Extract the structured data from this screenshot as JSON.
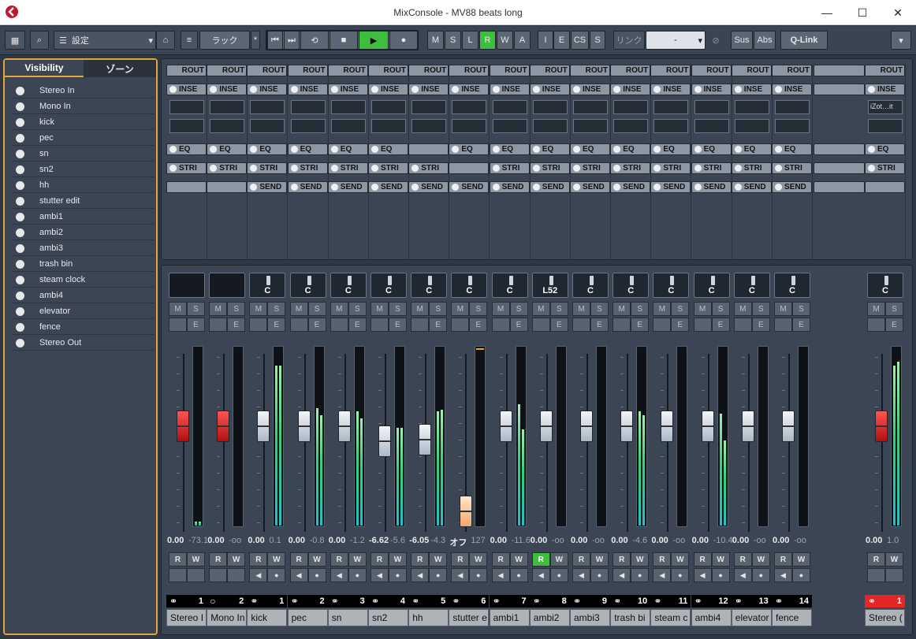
{
  "window": {
    "title": "MixConsole - MV88 beats long",
    "minimize": "—",
    "maximize": "☐",
    "close": "✕"
  },
  "toolbar": {
    "settings_label": "設定",
    "rack_label": "ラック",
    "star": "*",
    "modes": [
      "M",
      "S",
      "L",
      "R",
      "W",
      "A"
    ],
    "flags": [
      "I",
      "E",
      "CS",
      "S"
    ],
    "link_label": "リンク",
    "link_value": "-",
    "sus": "Sus",
    "abs": "Abs",
    "qlink": "Q-Link",
    "colors": {
      "rec_active": "#3fbd3f",
      "accent": "#e7a23a"
    }
  },
  "left_zone": {
    "tabs": [
      "Visibility",
      "ゾーン"
    ],
    "items": [
      "Stereo In",
      "Mono In",
      "kick",
      "pec",
      "sn",
      "sn2",
      "hh",
      "stutter edit",
      "ambi1",
      "ambi2",
      "ambi3",
      "trash bin",
      "steam clock",
      "ambi4",
      "elevator",
      "fence",
      "Stereo Out"
    ]
  },
  "rack_labels": {
    "routing": "ROUT",
    "inserts": "INSE",
    "eq": "EQ",
    "strip": "STRI",
    "sends": "SEND",
    "insert_plugin": "iZot…it"
  },
  "channel_labels": {
    "mute": "M",
    "solo": "S",
    "listen": "L",
    "edit": "E",
    "read": "R",
    "write": "W"
  },
  "channels": [
    {
      "name": "Stereo I",
      "num": "1",
      "pan": "",
      "vol": "0.00",
      "peak": "-73.1",
      "fader": 0.57,
      "cap": "red",
      "meter": [
        0.02,
        0.02
      ],
      "read": false
    },
    {
      "name": "Mono In",
      "num": "2",
      "pan": "",
      "vol": "0.00",
      "peak": "-oo",
      "fader": 0.57,
      "cap": "red",
      "meter": [
        0,
        0
      ],
      "read": false,
      "mono": true
    },
    {
      "name": "kick",
      "num": "1",
      "pan": "C",
      "vol": "0.00",
      "peak": "0.1",
      "fader": 0.57,
      "cap": "white",
      "meter": [
        0.9,
        0.9
      ],
      "read": false
    },
    {
      "name": "pec",
      "num": "2",
      "pan": "C",
      "vol": "0.00",
      "peak": "-0.8",
      "fader": 0.57,
      "cap": "white",
      "meter": [
        0.66,
        0.62
      ],
      "read": false
    },
    {
      "name": "sn",
      "num": "3",
      "pan": "C",
      "vol": "0.00",
      "peak": "-1.2",
      "fader": 0.57,
      "cap": "white",
      "meter": [
        0.64,
        0.6
      ],
      "read": false
    },
    {
      "name": "sn2",
      "num": "4",
      "pan": "C",
      "vol": "-6.62",
      "peak": "-5.6",
      "fader": 0.47,
      "cap": "white",
      "meter": [
        0.55,
        0.55
      ],
      "read": false
    },
    {
      "name": "hh",
      "num": "5",
      "pan": "C",
      "vol": "-6.05",
      "peak": "-4.3",
      "fader": 0.48,
      "cap": "white",
      "meter": [
        0.64,
        0.65
      ],
      "read": false
    },
    {
      "name": "stutter e",
      "num": "6",
      "pan": "C",
      "vol": "オフ",
      "peak": "127",
      "fader": 0.0,
      "cap": "orange",
      "meter": [
        0,
        0
      ],
      "read": false
    },
    {
      "name": "ambi1",
      "num": "7",
      "pan": "C",
      "vol": "0.00",
      "peak": "-11.6",
      "fader": 0.57,
      "cap": "white",
      "meter": [
        0.68,
        0.54
      ],
      "read": false
    },
    {
      "name": "ambi2",
      "num": "8",
      "pan": "L52",
      "vol": "0.00",
      "peak": "-oo",
      "fader": 0.57,
      "cap": "white",
      "meter": [
        0,
        0
      ],
      "read": true
    },
    {
      "name": "ambi3",
      "num": "9",
      "pan": "C",
      "vol": "0.00",
      "peak": "-oo",
      "fader": 0.57,
      "cap": "white",
      "meter": [
        0,
        0
      ],
      "read": false
    },
    {
      "name": "trash bi",
      "num": "10",
      "pan": "C",
      "vol": "0.00",
      "peak": "-4.6",
      "fader": 0.57,
      "cap": "white",
      "meter": [
        0.64,
        0.62
      ],
      "read": false
    },
    {
      "name": "steam c",
      "num": "11",
      "pan": "C",
      "vol": "0.00",
      "peak": "-oo",
      "fader": 0.57,
      "cap": "white",
      "meter": [
        0,
        0
      ],
      "read": false
    },
    {
      "name": "ambi4",
      "num": "12",
      "pan": "C",
      "vol": "0.00",
      "peak": "-10.4",
      "fader": 0.57,
      "cap": "white",
      "meter": [
        0.63,
        0.48
      ],
      "read": false
    },
    {
      "name": "elevator",
      "num": "13",
      "pan": "C",
      "vol": "0.00",
      "peak": "-oo",
      "fader": 0.57,
      "cap": "white",
      "meter": [
        0,
        0
      ],
      "read": false
    },
    {
      "name": "fence",
      "num": "14",
      "pan": "C",
      "vol": "0.00",
      "peak": "-oo",
      "fader": 0.57,
      "cap": "white",
      "meter": [
        0,
        0
      ],
      "read": false
    }
  ],
  "output": {
    "name": "Stereo (",
    "num": "1",
    "pan": "C",
    "vol": "0.00",
    "peak": "1.0",
    "fader": 0.57,
    "cap": "red",
    "meter": [
      0.9,
      0.92
    ]
  }
}
